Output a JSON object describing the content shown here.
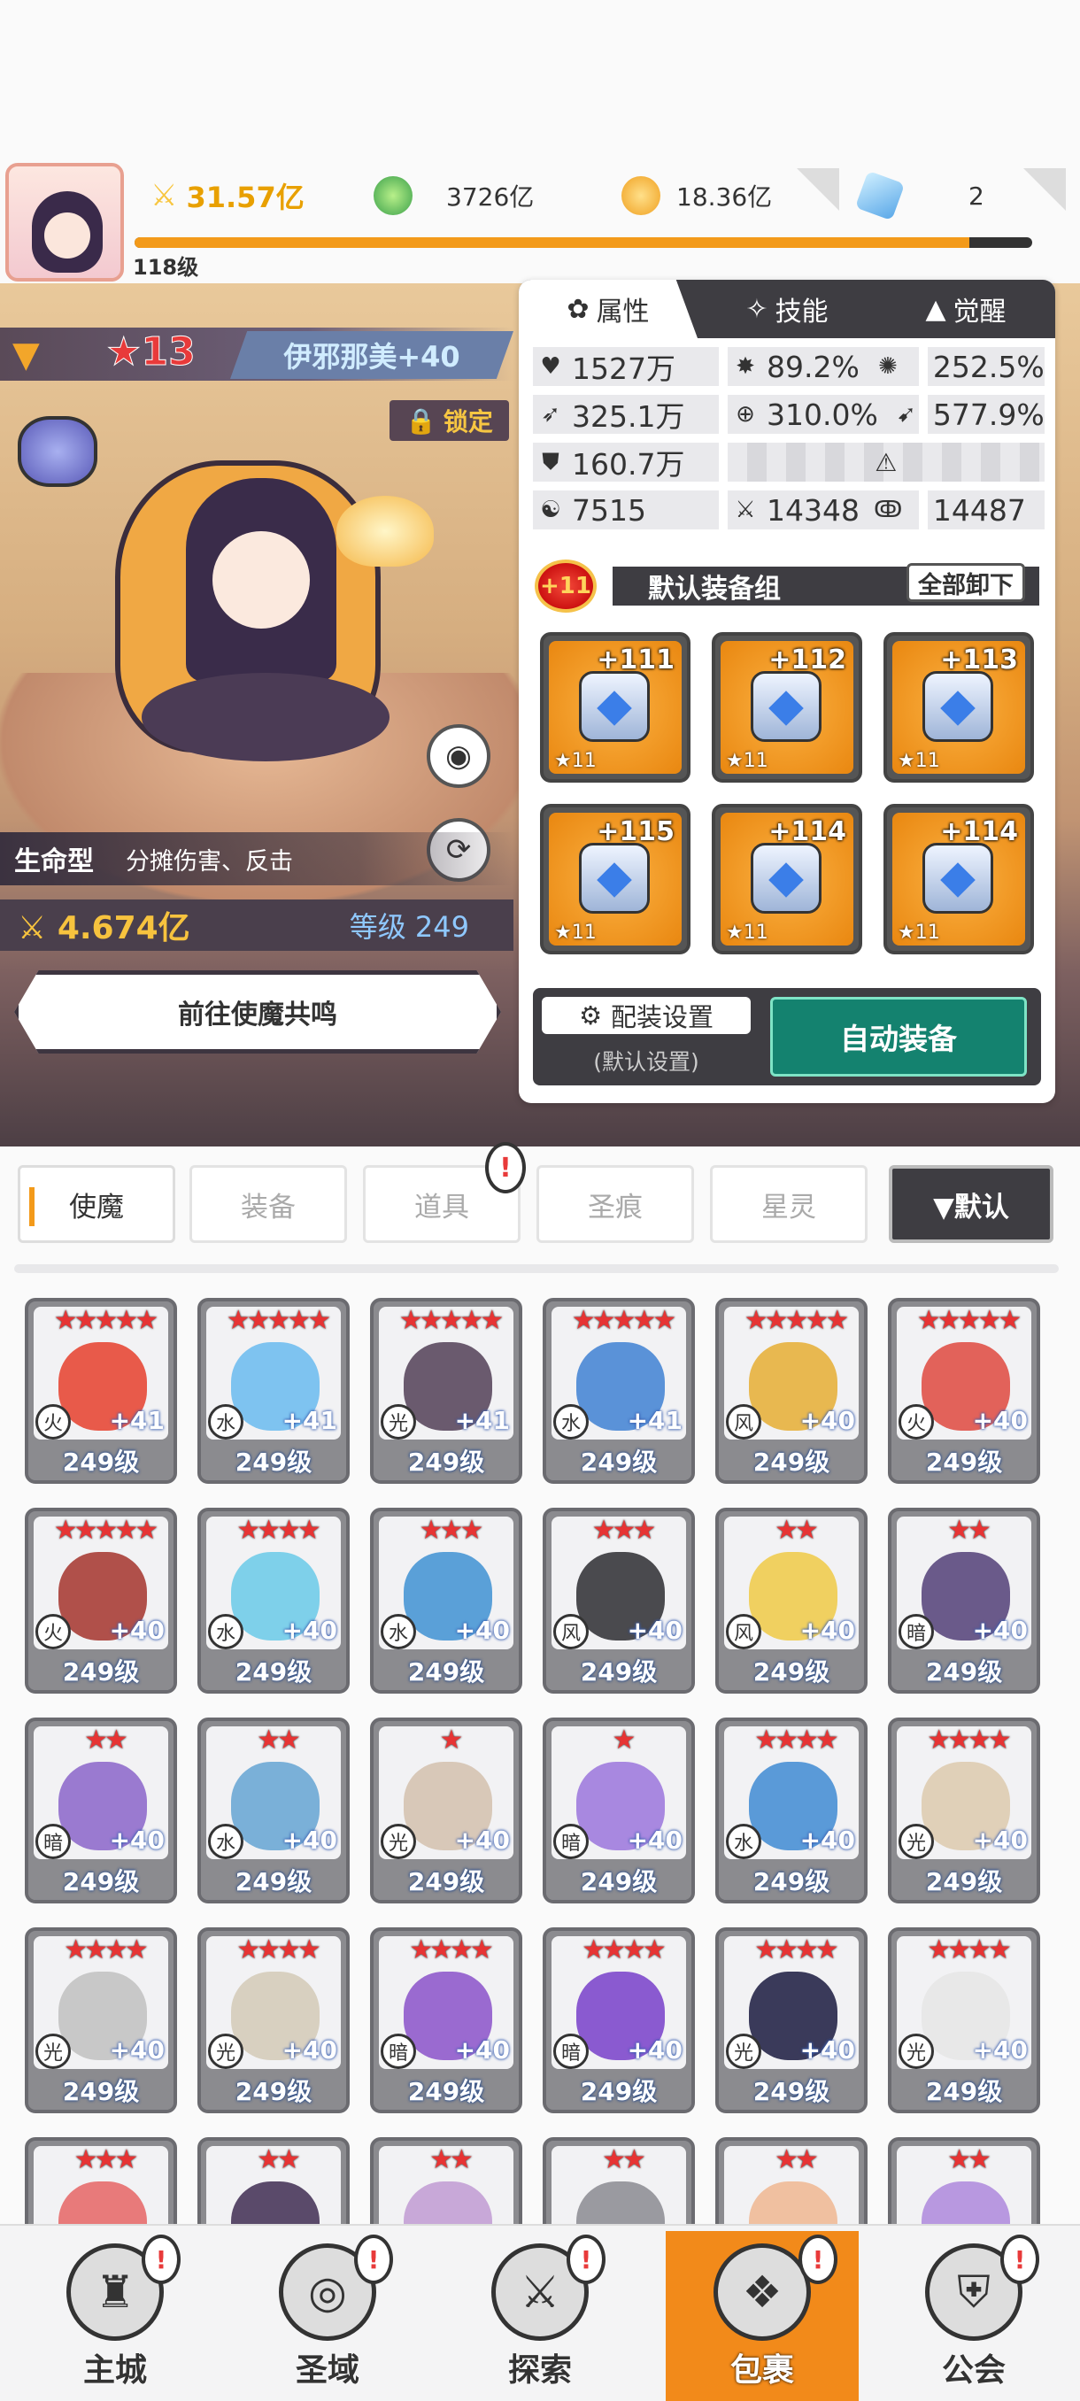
{
  "player": {
    "level": "118级",
    "power": "31.57亿",
    "progress": 0.93
  },
  "resources": {
    "green": "3726亿",
    "gold": "18.36亿",
    "gem": "2"
  },
  "hero": {
    "star": "13",
    "name": "伊邪那美+40",
    "lock_label": "锁定",
    "type": "生命型",
    "desc": "分摊伤害、反击",
    "power": "4.674亿",
    "level": "等级 249",
    "go_button": "前往使魔共鸣"
  },
  "panel": {
    "tabs": [
      {
        "label": "属性"
      },
      {
        "label": "技能"
      },
      {
        "label": "觉醒"
      }
    ],
    "stats": {
      "hp": "1527万",
      "crit": "89.2%",
      "crit_dmg": "252.5%",
      "atk": "325.1万",
      "acc": "310.0%",
      "speed": "577.9%",
      "def": "160.7万",
      "s1": "7515",
      "s2": "14348",
      "s3": "14487"
    },
    "loadout_badge": "+11",
    "loadout_name": "默认装备组",
    "unequip_all": "全部卸下",
    "equipment": [
      {
        "plus": "+111",
        "star": "★11"
      },
      {
        "plus": "+112",
        "star": "★11"
      },
      {
        "plus": "+113",
        "star": "★11"
      },
      {
        "plus": "+115",
        "star": "★11"
      },
      {
        "plus": "+114",
        "star": "★11"
      },
      {
        "plus": "+114",
        "star": "★11"
      }
    ],
    "config_label": "配装设置",
    "config_sub": "(默认设置)",
    "auto_equip": "自动装备"
  },
  "categories": [
    "使魔",
    "装备",
    "道具",
    "圣痕",
    "星灵"
  ],
  "sort_label": "▼默认",
  "roster": [
    {
      "stars": "★★★★★",
      "plus": "+41",
      "level": "249级",
      "color": "#e85a4a",
      "elem": "火"
    },
    {
      "stars": "★★★★★",
      "plus": "+41",
      "level": "249级",
      "color": "#7ec3f0",
      "elem": "水"
    },
    {
      "stars": "★★★★★",
      "plus": "+41",
      "level": "249级",
      "color": "#6a5a6e",
      "elem": "光"
    },
    {
      "stars": "★★★★★",
      "plus": "+41",
      "level": "249级",
      "color": "#5a92d8",
      "elem": "水"
    },
    {
      "stars": "★★★★★",
      "plus": "+40",
      "level": "249级",
      "color": "#e8b850",
      "elem": "风"
    },
    {
      "stars": "★★★★★",
      "plus": "+40",
      "level": "249级",
      "color": "#e2625a",
      "elem": "火"
    },
    {
      "stars": "★★★★★",
      "plus": "+40",
      "level": "249级",
      "color": "#b0504a",
      "elem": "火"
    },
    {
      "stars": "★★★★",
      "plus": "+40",
      "level": "249级",
      "color": "#7ed0ea",
      "elem": "水"
    },
    {
      "stars": "★★★",
      "plus": "+40",
      "level": "249级",
      "color": "#5aa0d8",
      "elem": "水"
    },
    {
      "stars": "★★★",
      "plus": "+40",
      "level": "249级",
      "color": "#4a4a4e",
      "elem": "风"
    },
    {
      "stars": "★★",
      "plus": "+40",
      "level": "249级",
      "color": "#f0d060",
      "elem": "风"
    },
    {
      "stars": "★★",
      "plus": "+40",
      "level": "249级",
      "color": "#6a5a8a",
      "elem": "暗"
    },
    {
      "stars": "★★",
      "plus": "+40",
      "level": "249级",
      "color": "#9a7ad0",
      "elem": "暗"
    },
    {
      "stars": "★★",
      "plus": "+40",
      "level": "249级",
      "color": "#7ab0d8",
      "elem": "水"
    },
    {
      "stars": "★",
      "plus": "+40",
      "level": "249级",
      "color": "#d8c8b8",
      "elem": "光"
    },
    {
      "stars": "★",
      "plus": "+40",
      "level": "249级",
      "color": "#a888e0",
      "elem": "暗"
    },
    {
      "stars": "★★★★",
      "plus": "+40",
      "level": "249级",
      "color": "#5a9ad8",
      "elem": "水"
    },
    {
      "stars": "★★★★",
      "plus": "+40",
      "level": "249级",
      "color": "#e0d0b8",
      "elem": "光"
    },
    {
      "stars": "★★★★",
      "plus": "+40",
      "level": "249级",
      "color": "#c8c8c8",
      "elem": "光"
    },
    {
      "stars": "★★★★",
      "plus": "+40",
      "level": "249级",
      "color": "#d8d0c0",
      "elem": "光"
    },
    {
      "stars": "★★★★",
      "plus": "+40",
      "level": "249级",
      "color": "#9a6ad0",
      "elem": "暗"
    },
    {
      "stars": "★★★★",
      "plus": "+40",
      "level": "249级",
      "color": "#8a5ad0",
      "elem": "暗"
    },
    {
      "stars": "★★★★",
      "plus": "+40",
      "level": "249级",
      "color": "#3a3a5a",
      "elem": "光"
    },
    {
      "stars": "★★★★",
      "plus": "+40",
      "level": "249级",
      "color": "#e8e8e8",
      "elem": "光"
    },
    {
      "stars": "★★★",
      "plus": "",
      "level": "",
      "color": "#e87a7a",
      "elem": ""
    },
    {
      "stars": "★★",
      "plus": "",
      "level": "",
      "color": "#5a4a6a",
      "elem": ""
    },
    {
      "stars": "★★",
      "plus": "",
      "level": "",
      "color": "#c8a8d8",
      "elem": ""
    },
    {
      "stars": "★★",
      "plus": "",
      "level": "",
      "color": "#9a9aa0",
      "elem": ""
    },
    {
      "stars": "★★",
      "plus": "",
      "level": "",
      "color": "#f0c0a0",
      "elem": ""
    },
    {
      "stars": "★★",
      "plus": "",
      "level": "",
      "color": "#b898e0",
      "elem": ""
    }
  ],
  "nav": [
    {
      "label": "主城",
      "icon": "castle-icon"
    },
    {
      "label": "圣域",
      "icon": "portal-icon"
    },
    {
      "label": "探索",
      "icon": "sword-icon"
    },
    {
      "label": "包裹",
      "icon": "bag-icon"
    },
    {
      "label": "公会",
      "icon": "guild-icon"
    }
  ],
  "colors": {
    "accent": "#f39a1a",
    "auto_btn": "#14826f",
    "power": "#e8a000",
    "dark": "#3e3d42"
  }
}
